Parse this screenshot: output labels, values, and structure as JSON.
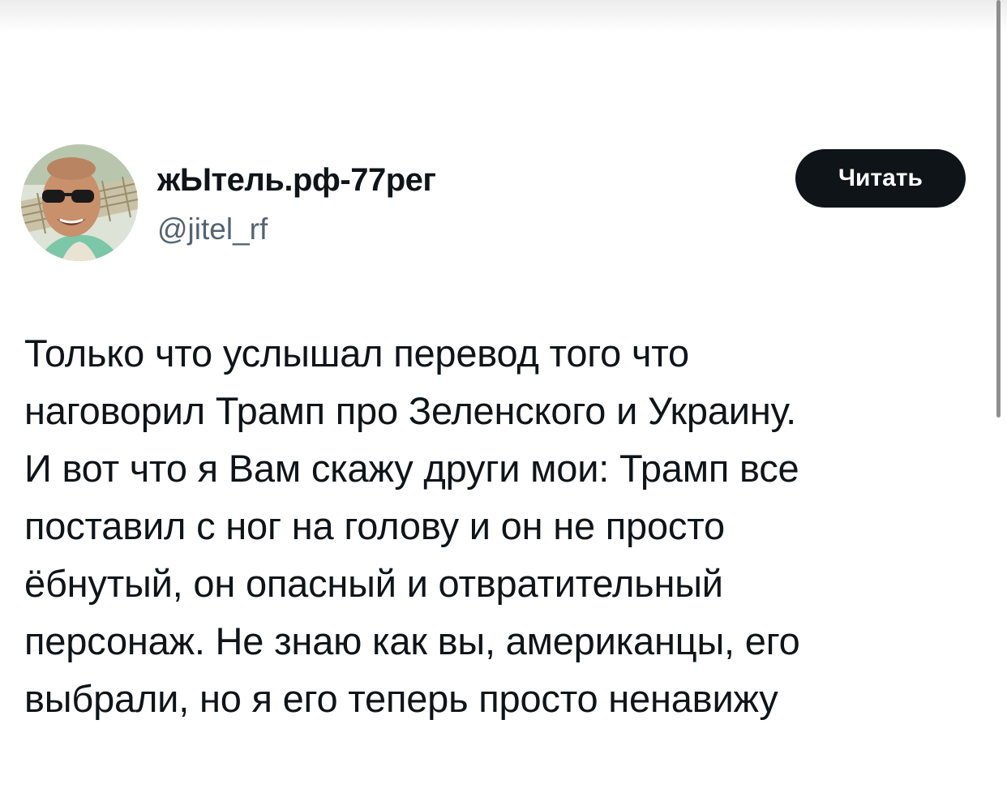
{
  "author": {
    "display_name": "жЫтель.рф-77рег",
    "handle": "@jitel_rf",
    "avatar_icon": "profile-photo-man-with-sunglasses"
  },
  "follow_button": {
    "label": "Читать"
  },
  "tweet": {
    "lines": [
      "Только что услышал перевод того что",
      "наговорил Трамп про Зеленского и Украину.",
      "И вот что я Вам скажу други мои: Трамп все",
      "поставил с ног на голову и он не просто",
      "ёбнутый, он опасный и отвратительный",
      "персонаж. Не знаю как вы, американцы, его",
      "выбрали, но я его теперь просто ненавижу"
    ]
  },
  "colors": {
    "text_primary": "#0f1419",
    "text_secondary": "#536471",
    "button_bg": "#0f1419",
    "button_text": "#ffffff",
    "background": "#ffffff"
  }
}
